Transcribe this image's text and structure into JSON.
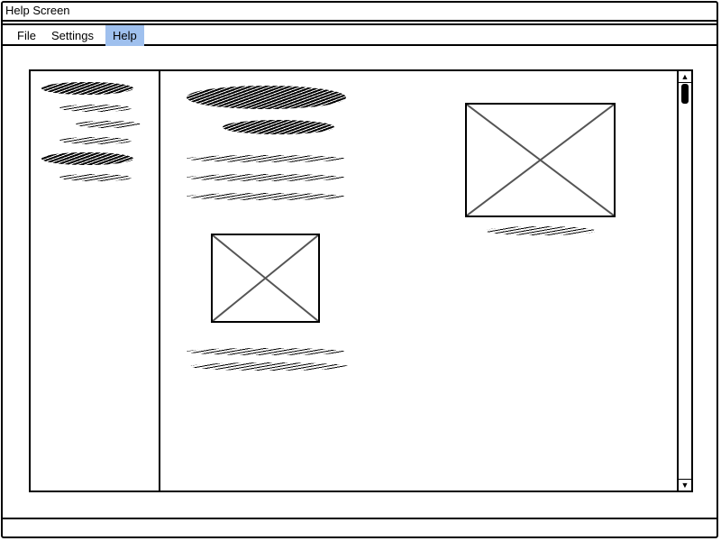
{
  "window": {
    "title": "Help Screen"
  },
  "menu": {
    "items": [
      {
        "label": "File"
      },
      {
        "label": "Settings"
      },
      {
        "label": "Help",
        "active": true
      }
    ],
    "active_color": "#9fc0ee"
  },
  "content": {
    "placeholders": [
      "image-placeholder-large",
      "image-placeholder-small"
    ]
  },
  "icons": {
    "scroll_up": "scroll-up-arrow-icon",
    "scroll_down": "scroll-down-arrow-icon",
    "image": "image-placeholder-icon"
  }
}
